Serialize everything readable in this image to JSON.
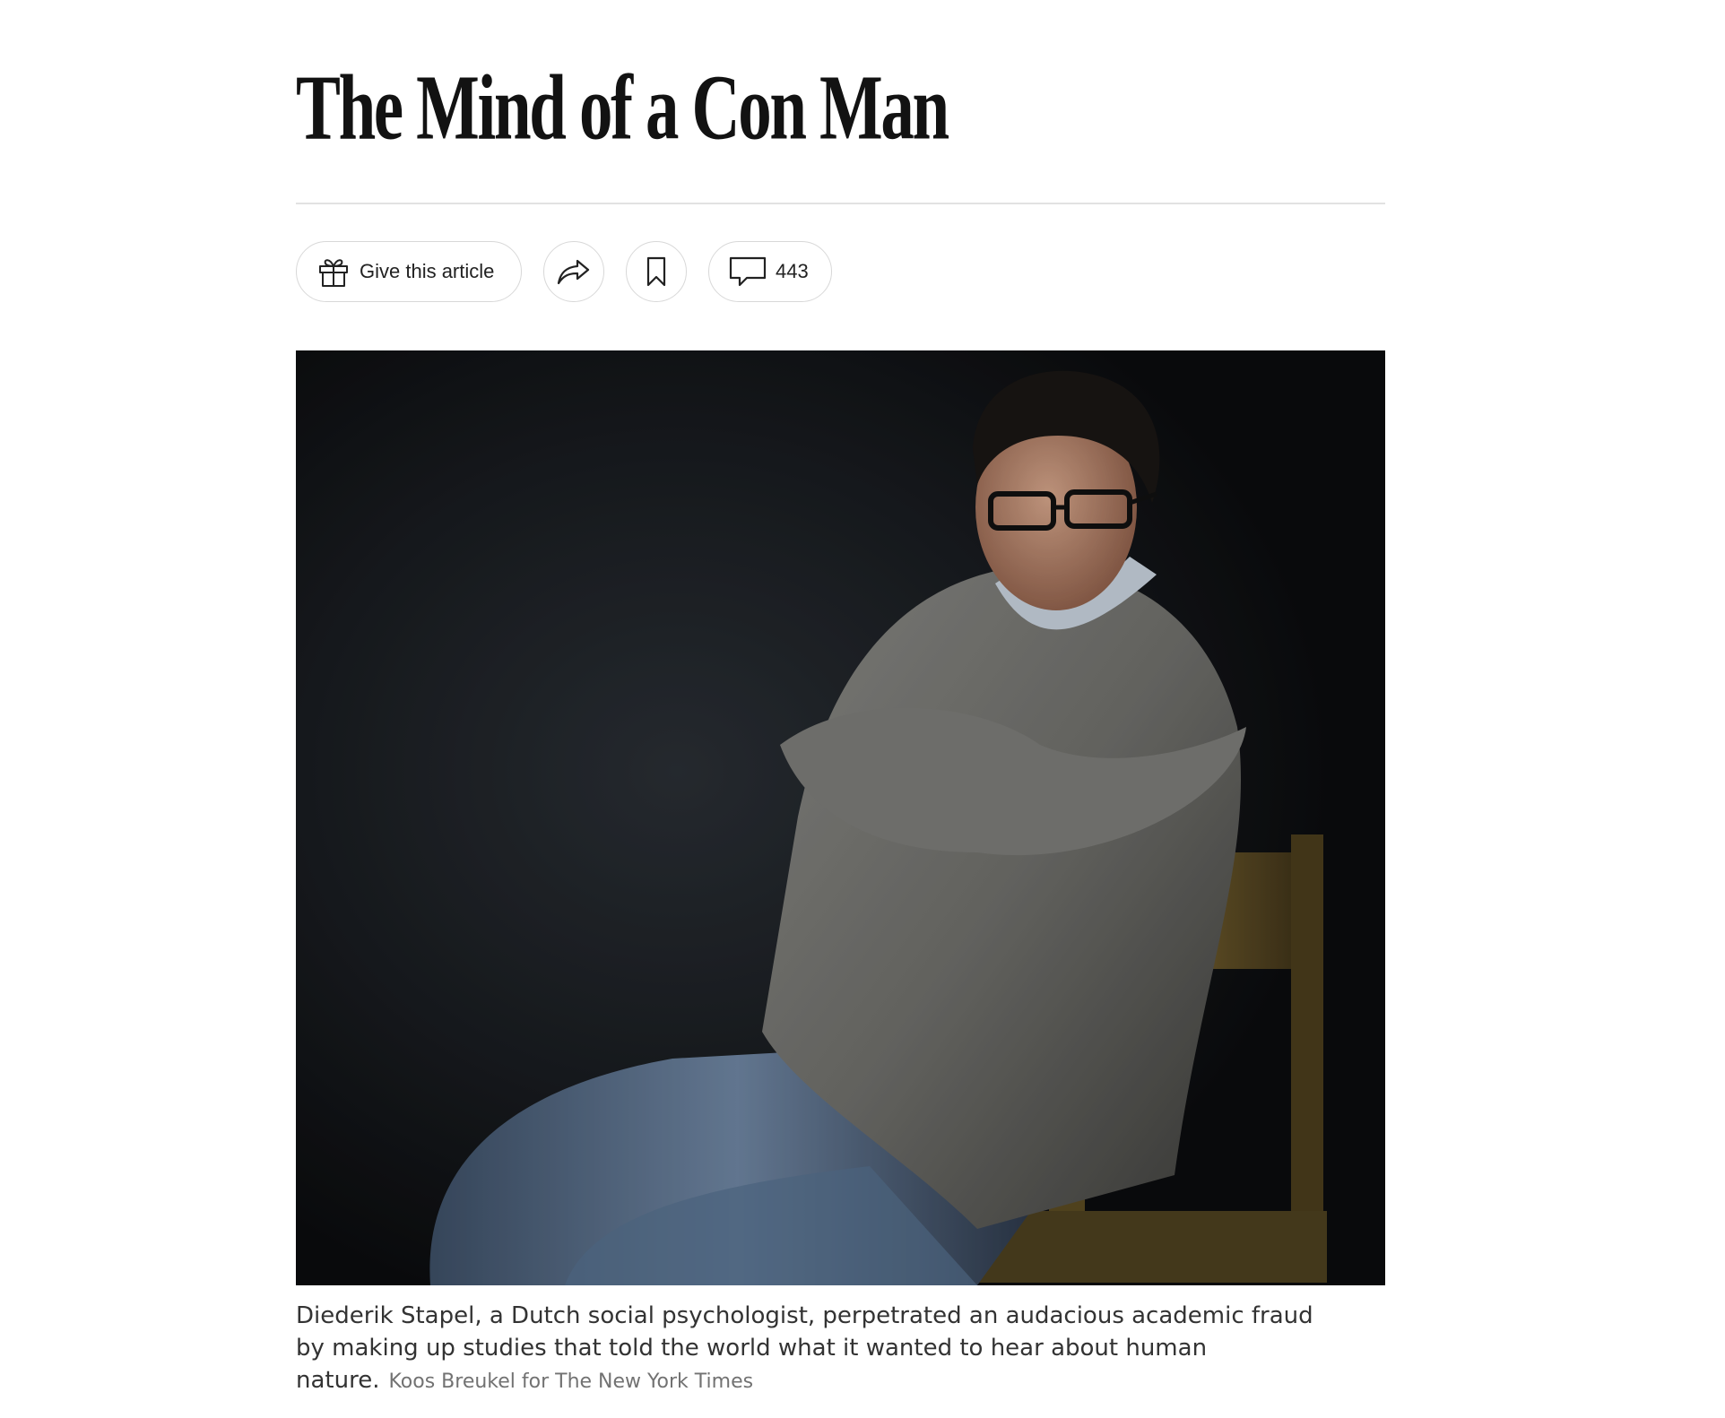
{
  "article": {
    "headline": "The Mind of a Con Man"
  },
  "toolbar": {
    "gift_label": "Give this article",
    "comment_count": "443",
    "icons": {
      "gift": "gift-icon",
      "share": "share-arrow-icon",
      "save": "bookmark-icon",
      "comments": "speech-bubble-icon"
    }
  },
  "photo": {
    "caption": "Diederik Stapel, a Dutch social psychologist, perpetrated an audacious academic fraud by making up studies that told the world what it wanted to hear about human nature.",
    "credit": "Koos Breukel for The New York Times"
  },
  "colors": {
    "text": "#121212",
    "border": "#d8d8d8",
    "credit": "#727272",
    "photo_background": "#121417"
  }
}
